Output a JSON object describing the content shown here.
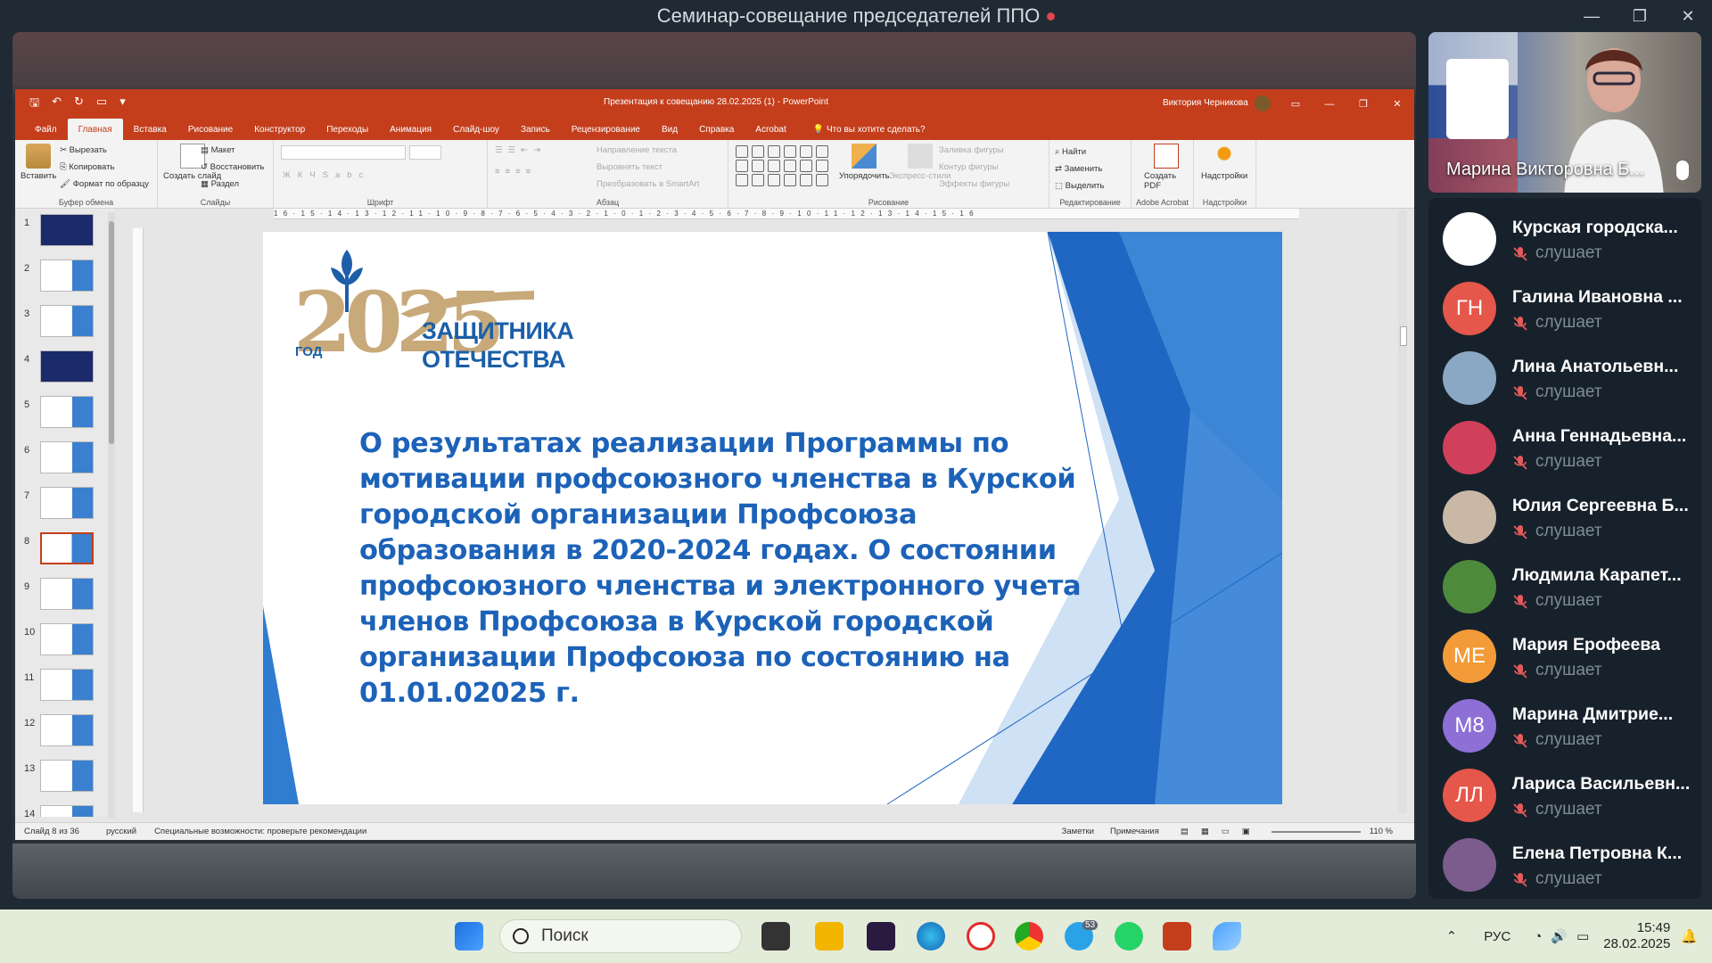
{
  "call": {
    "title": "Семинар-совещание председателей ППО",
    "controls": [
      "—",
      "❐",
      "✕"
    ]
  },
  "powerpoint": {
    "doc_title": "Презентация к совещанию 28.02.2025 (1)  -  PowerPoint",
    "user": "Виктория Черникова",
    "tabs": [
      "Файл",
      "Главная",
      "Вставка",
      "Рисование",
      "Конструктор",
      "Переходы",
      "Анимация",
      "Слайд-шоу",
      "Запись",
      "Рецензирование",
      "Вид",
      "Справка",
      "Acrobat"
    ],
    "active_tab": "Главная",
    "tell_me": "Что вы хотите сделать?",
    "ribbon": {
      "clipboard": {
        "paste": "Вставить",
        "cut": "Вырезать",
        "copy": "Копировать",
        "format_painter": "Формат по образцу",
        "label": "Буфер обмена"
      },
      "slides": {
        "new_slide": "Создать слайд",
        "layout": "Макет",
        "reset": "Восстановить",
        "section": "Раздел",
        "label": "Слайды"
      },
      "font": {
        "label": "Шрифт"
      },
      "paragraph": {
        "text_direction": "Направление текста",
        "align_text": "Выровнять текст",
        "smartart": "Преобразовать в SmartArt",
        "label": "Абзац"
      },
      "drawing": {
        "arrange": "Упорядочить",
        "quick_styles": "Экспресс-стили",
        "fill": "Заливка фигуры",
        "outline": "Контур фигуры",
        "effects": "Эффекты фигуры",
        "label": "Рисование"
      },
      "editing": {
        "find": "Найти",
        "replace": "Заменить",
        "select": "Выделить",
        "label": "Редактирование"
      },
      "acrobat": {
        "create_pdf": "Создать PDF",
        "label": "Adobe Acrobat"
      },
      "addins": {
        "button": "Надстройки",
        "label": "Надстройки"
      }
    },
    "thumbnails": [
      "1",
      "2",
      "3",
      "4",
      "5",
      "6",
      "7",
      "8",
      "9",
      "10",
      "11",
      "12",
      "13",
      "14"
    ],
    "selected_slide": 8,
    "ruler": "16·15·14·13·12·11·10·9·8·7·6·5·4·3·2·1·0·1·2·3·4·5·6·7·8·9·10·11·12·13·14·15·16",
    "slide": {
      "logo_year": "2025",
      "logo_god": "ГОД",
      "logo_line1": "ЗАЩИТНИКА",
      "logo_line2": "ОТЕЧЕСТВА",
      "title": "О результатах реализации Программы по мотивации профсоюзного членства в Курской городской организации Профсоюза образования в 2020-2024 годах. О состоянии профсоюзного членства и электронного учета членов Профсоюза в Курской городской организации Профсоюза по состоянию на 01.01.02025 г."
    },
    "status": {
      "slide_of": "Слайд 8 из 36",
      "language": "русский",
      "accessibility": "Специальные возможности: проверьте рекомендации",
      "notes": "Заметки",
      "comments": "Примечания",
      "zoom": "110 %"
    }
  },
  "speaker": {
    "name": "Марина Викторовна Б..."
  },
  "participants": [
    {
      "name": "Курская городска...",
      "status": "слушает",
      "initials": "",
      "color": "#ffffff"
    },
    {
      "name": "Галина Ивановна ...",
      "status": "слушает",
      "initials": "ГН",
      "color": "#e5574a"
    },
    {
      "name": "Лина Анатольевн...",
      "status": "слушает",
      "initials": "",
      "color": "#8aa7c4"
    },
    {
      "name": "Анна Геннадьевна...",
      "status": "слушает",
      "initials": "",
      "color": "#d0405a"
    },
    {
      "name": "Юлия Сергеевна Б...",
      "status": "слушает",
      "initials": "",
      "color": "#c9b8a6"
    },
    {
      "name": "Людмила Карапет...",
      "status": "слушает",
      "initials": "",
      "color": "#4d8a3c"
    },
    {
      "name": "Мария Ерофеева",
      "status": "слушает",
      "initials": "МЕ",
      "color": "#f29b38"
    },
    {
      "name": "Марина Дмитрие...",
      "status": "слушает",
      "initials": "М8",
      "color": "#8e6fd6"
    },
    {
      "name": "Лариса Васильевн...",
      "status": "слушает",
      "initials": "ЛЛ",
      "color": "#e5574a"
    },
    {
      "name": "Елена Петровна К...",
      "status": "слушает",
      "initials": "",
      "color": "#7b5c8d"
    }
  ],
  "taskbar": {
    "search": "Поиск",
    "telegram_badge": "53",
    "language": "РУС",
    "time": "15:49",
    "date": "28.02.2025"
  }
}
